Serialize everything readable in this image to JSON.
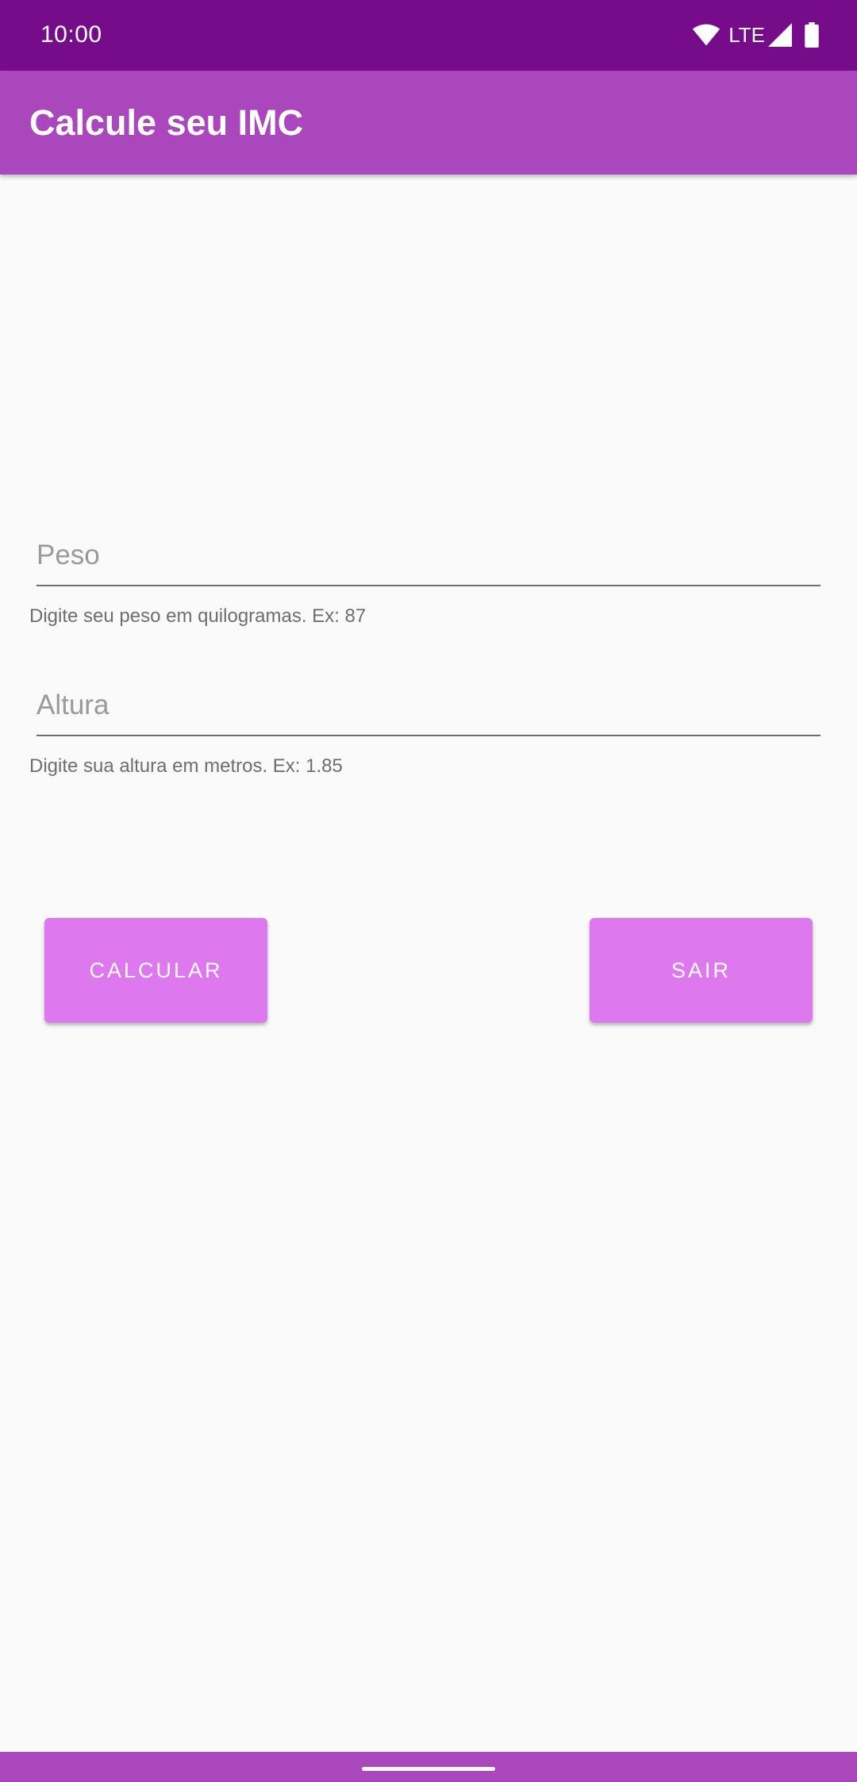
{
  "status_bar": {
    "time": "10:00",
    "network": "LTE",
    "icons": [
      "wifi-icon",
      "signal-icon",
      "battery-icon"
    ]
  },
  "app_bar": {
    "title": "Calcule seu IMC"
  },
  "form": {
    "weight": {
      "placeholder": "Peso",
      "value": "",
      "helper": "Digite seu peso em quilogramas. Ex: 87"
    },
    "height": {
      "placeholder": "Altura",
      "value": "",
      "helper": "Digite sua altura em metros. Ex: 1.85"
    }
  },
  "actions": {
    "calculate_label": "CALCULAR",
    "exit_label": "SAIR"
  },
  "colors": {
    "status_bar": "#760c8a",
    "app_bar": "#ab47bc",
    "button": "#dd78ee",
    "background": "#fafafa"
  }
}
